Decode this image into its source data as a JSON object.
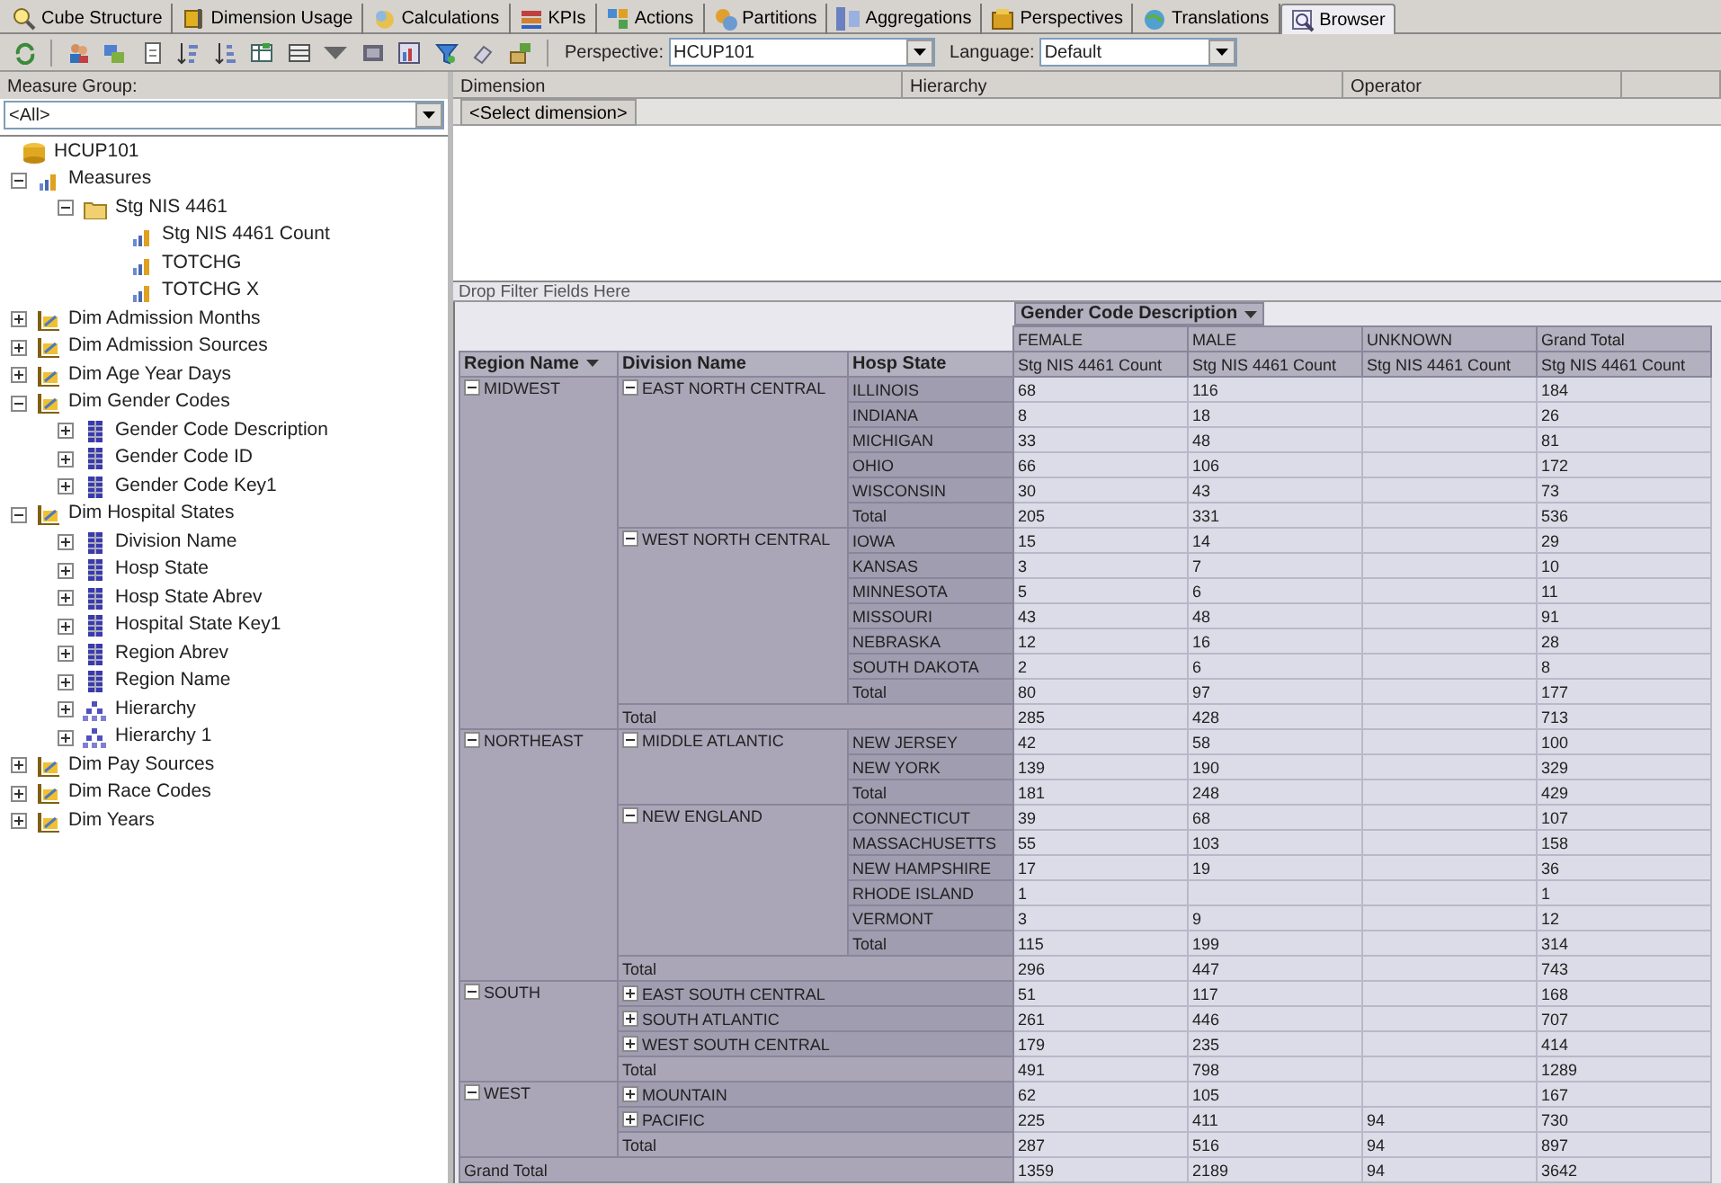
{
  "tabs": [
    {
      "label": "Cube Structure",
      "selected": false
    },
    {
      "label": "Dimension Usage",
      "selected": false
    },
    {
      "label": "Calculations",
      "selected": false
    },
    {
      "label": "KPIs",
      "selected": false
    },
    {
      "label": "Actions",
      "selected": false
    },
    {
      "label": "Partitions",
      "selected": false
    },
    {
      "label": "Aggregations",
      "selected": false
    },
    {
      "label": "Perspectives",
      "selected": false
    },
    {
      "label": "Translations",
      "selected": false
    },
    {
      "label": "Browser",
      "selected": true
    }
  ],
  "toolbar": {
    "perspective_label": "Perspective:",
    "perspective": "HCUP101",
    "language_label": "Language:",
    "language": "Default"
  },
  "measure_group": {
    "label": "Measure Group:",
    "value": "<All>"
  },
  "tree": [
    {
      "label": "HCUP101",
      "kind": "cube",
      "children": [
        {
          "label": "Measures",
          "kind": "measures",
          "expanded": true,
          "children": [
            {
              "label": "Stg NIS 4461",
              "kind": "folder",
              "expanded": true,
              "children": [
                {
                  "label": "Stg NIS 4461 Count",
                  "kind": "measure"
                },
                {
                  "label": "TOTCHG",
                  "kind": "measure"
                },
                {
                  "label": "TOTCHG X",
                  "kind": "measure"
                }
              ]
            }
          ]
        },
        {
          "label": "Dim Admission Months",
          "kind": "dimension",
          "expanded": false
        },
        {
          "label": "Dim Admission Sources",
          "kind": "dimension",
          "expanded": false
        },
        {
          "label": "Dim Age Year Days",
          "kind": "dimension",
          "expanded": false
        },
        {
          "label": "Dim Gender Codes",
          "kind": "dimension",
          "expanded": true,
          "children": [
            {
              "label": "Gender Code Description",
              "kind": "attribute",
              "expanded": false
            },
            {
              "label": "Gender Code ID",
              "kind": "attribute",
              "expanded": false
            },
            {
              "label": "Gender Code Key1",
              "kind": "attribute",
              "expanded": false
            }
          ]
        },
        {
          "label": "Dim Hospital States",
          "kind": "dimension",
          "expanded": true,
          "children": [
            {
              "label": "Division Name",
              "kind": "attribute",
              "expanded": false
            },
            {
              "label": "Hosp State",
              "kind": "attribute",
              "expanded": false
            },
            {
              "label": "Hosp State Abrev",
              "kind": "attribute",
              "expanded": false
            },
            {
              "label": "Hospital State Key1",
              "kind": "attribute",
              "expanded": false
            },
            {
              "label": "Region Abrev",
              "kind": "attribute",
              "expanded": false
            },
            {
              "label": "Region Name",
              "kind": "attribute",
              "expanded": false
            },
            {
              "label": "Hierarchy",
              "kind": "hierarchy",
              "expanded": false
            },
            {
              "label": "Hierarchy 1",
              "kind": "hierarchy",
              "expanded": false
            }
          ]
        },
        {
          "label": "Dim Pay Sources",
          "kind": "dimension",
          "expanded": false
        },
        {
          "label": "Dim Race Codes",
          "kind": "dimension",
          "expanded": false
        },
        {
          "label": "Dim Years",
          "kind": "dimension",
          "expanded": false
        }
      ]
    }
  ],
  "filter_grid": {
    "columns": [
      "Dimension",
      "Hierarchy",
      "Operator"
    ],
    "select_row": "<Select dimension>"
  },
  "drop_filter_hint": "Drop Filter Fields Here",
  "pivot": {
    "column_field": "Gender Code Description",
    "column_members": {
      "female": "FEMALE",
      "male": "MALE",
      "unknown": "UNKNOWN",
      "grand_total": "Grand Total"
    },
    "measure_headers": {
      "female": "Stg NIS 4461 Count",
      "male": "Stg NIS 4461 Count",
      "unknown": "Stg NIS 4461 Count",
      "grand_total": "Stg NIS 4461 Count"
    },
    "row_fields": [
      "Region Name",
      "Division Name",
      "Hosp State"
    ],
    "regions": [
      {
        "name": "MIDWEST",
        "expanded": true,
        "divisions": [
          {
            "name": "EAST NORTH CENTRAL",
            "expanded": true,
            "states": [
              {
                "name": "ILLINOIS",
                "values": {
                  "female": "68",
                  "male": "116",
                  "grand_total": "184"
                }
              },
              {
                "name": "INDIANA",
                "values": {
                  "female": "8",
                  "male": "18",
                  "grand_total": "26"
                }
              },
              {
                "name": "MICHIGAN",
                "values": {
                  "female": "33",
                  "male": "48",
                  "grand_total": "81"
                }
              },
              {
                "name": "OHIO",
                "values": {
                  "female": "66",
                  "male": "106",
                  "grand_total": "172"
                }
              },
              {
                "name": "WISCONSIN",
                "values": {
                  "female": "30",
                  "male": "43",
                  "grand_total": "73"
                }
              }
            ],
            "total": {
              "label": "Total",
              "values": {
                "female": "205",
                "male": "331",
                "grand_total": "536"
              }
            }
          },
          {
            "name": "WEST NORTH CENTRAL",
            "expanded": true,
            "states": [
              {
                "name": "IOWA",
                "values": {
                  "female": "15",
                  "male": "14",
                  "grand_total": "29"
                }
              },
              {
                "name": "KANSAS",
                "values": {
                  "female": "3",
                  "male": "7",
                  "grand_total": "10"
                }
              },
              {
                "name": "MINNESOTA",
                "values": {
                  "female": "5",
                  "male": "6",
                  "grand_total": "11"
                }
              },
              {
                "name": "MISSOURI",
                "values": {
                  "female": "43",
                  "male": "48",
                  "grand_total": "91"
                }
              },
              {
                "name": "NEBRASKA",
                "values": {
                  "female": "12",
                  "male": "16",
                  "grand_total": "28"
                }
              },
              {
                "name": "SOUTH DAKOTA",
                "values": {
                  "female": "2",
                  "male": "6",
                  "grand_total": "8"
                }
              }
            ],
            "total": {
              "label": "Total",
              "values": {
                "female": "80",
                "male": "97",
                "grand_total": "177"
              }
            }
          }
        ],
        "total": {
          "label": "Total",
          "values": {
            "female": "285",
            "male": "428",
            "grand_total": "713"
          }
        }
      },
      {
        "name": "NORTHEAST",
        "expanded": true,
        "divisions": [
          {
            "name": "MIDDLE ATLANTIC",
            "expanded": true,
            "states": [
              {
                "name": "NEW JERSEY",
                "values": {
                  "female": "42",
                  "male": "58",
                  "grand_total": "100"
                }
              },
              {
                "name": "NEW YORK",
                "values": {
                  "female": "139",
                  "male": "190",
                  "grand_total": "329"
                }
              }
            ],
            "total": {
              "label": "Total",
              "values": {
                "female": "181",
                "male": "248",
                "grand_total": "429"
              }
            }
          },
          {
            "name": "NEW ENGLAND",
            "expanded": true,
            "states": [
              {
                "name": "CONNECTICUT",
                "values": {
                  "female": "39",
                  "male": "68",
                  "grand_total": "107"
                }
              },
              {
                "name": "MASSACHUSETTS",
                "values": {
                  "female": "55",
                  "male": "103",
                  "grand_total": "158"
                }
              },
              {
                "name": "NEW HAMPSHIRE",
                "values": {
                  "female": "17",
                  "male": "19",
                  "grand_total": "36"
                }
              },
              {
                "name": "RHODE ISLAND",
                "values": {
                  "female": "1",
                  "grand_total": "1"
                }
              },
              {
                "name": "VERMONT",
                "values": {
                  "female": "3",
                  "male": "9",
                  "grand_total": "12"
                }
              }
            ],
            "total": {
              "label": "Total",
              "values": {
                "female": "115",
                "male": "199",
                "grand_total": "314"
              }
            }
          }
        ],
        "total": {
          "label": "Total",
          "values": {
            "female": "296",
            "male": "447",
            "grand_total": "743"
          }
        }
      },
      {
        "name": "SOUTH",
        "expanded": true,
        "divisions": [
          {
            "name": "EAST SOUTH CENTRAL",
            "expanded": false,
            "values": {
              "female": "51",
              "male": "117",
              "grand_total": "168"
            }
          },
          {
            "name": "SOUTH ATLANTIC",
            "expanded": false,
            "values": {
              "female": "261",
              "male": "446",
              "grand_total": "707"
            }
          },
          {
            "name": "WEST SOUTH CENTRAL",
            "expanded": false,
            "values": {
              "female": "179",
              "male": "235",
              "grand_total": "414"
            }
          }
        ],
        "total": {
          "label": "Total",
          "values": {
            "female": "491",
            "male": "798",
            "grand_total": "1289"
          }
        }
      },
      {
        "name": "WEST",
        "expanded": true,
        "divisions": [
          {
            "name": "MOUNTAIN",
            "expanded": false,
            "values": {
              "female": "62",
              "male": "105",
              "grand_total": "167"
            }
          },
          {
            "name": "PACIFIC",
            "expanded": false,
            "values": {
              "female": "225",
              "male": "411",
              "unknown": "94",
              "grand_total": "730"
            }
          }
        ],
        "total": {
          "label": "Total",
          "values": {
            "female": "287",
            "male": "516",
            "unknown": "94",
            "grand_total": "897"
          }
        }
      }
    ],
    "grand_total": {
      "label": "Grand Total",
      "values": {
        "female": "1359",
        "male": "2189",
        "unknown": "94",
        "grand_total": "3642"
      }
    }
  }
}
